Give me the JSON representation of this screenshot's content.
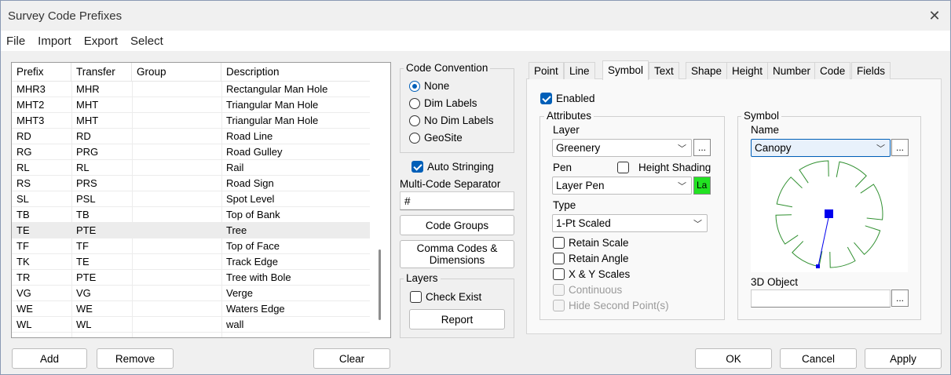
{
  "window": {
    "title": "Survey Code Prefixes"
  },
  "menu": [
    "File",
    "Import",
    "Export",
    "Select"
  ],
  "list": {
    "columns": [
      "Prefix",
      "Transfer",
      "Group",
      "Description"
    ],
    "rows": [
      [
        "MHR3",
        "MHR",
        "",
        "Rectangular Man Hole"
      ],
      [
        "MHT2",
        "MHT",
        "",
        "Triangular Man Hole"
      ],
      [
        "MHT3",
        "MHT",
        "",
        "Triangular Man Hole"
      ],
      [
        "RD",
        "RD",
        "",
        "Road Line"
      ],
      [
        "RG",
        "PRG",
        "",
        "Road Gulley"
      ],
      [
        "RL",
        "RL",
        "",
        "Rail"
      ],
      [
        "RS",
        "PRS",
        "",
        "Road Sign"
      ],
      [
        "SL",
        "PSL",
        "",
        "Spot Level"
      ],
      [
        "TB",
        "TB",
        "",
        "Top of Bank"
      ],
      [
        "TE",
        "PTE",
        "",
        "Tree"
      ],
      [
        "TF",
        "TF",
        "",
        "Top of Face"
      ],
      [
        "TK",
        "TE",
        "",
        "Track Edge"
      ],
      [
        "TR",
        "PTE",
        "",
        "Tree with Bole"
      ],
      [
        "VG",
        "VG",
        "",
        "Verge"
      ],
      [
        "WE",
        "WE",
        "",
        "Waters Edge"
      ],
      [
        "WL",
        "WL",
        "",
        "wall"
      ]
    ],
    "selected_index": 9
  },
  "code_convention": {
    "label": "Code Convention",
    "options": [
      "None",
      "Dim Labels",
      "No Dim Labels",
      "GeoSite"
    ],
    "selected": "None"
  },
  "auto_stringing": {
    "label": "Auto Stringing",
    "checked": true
  },
  "multi_code_separator": {
    "label": "Multi-Code Separator",
    "value": "#"
  },
  "buttons": {
    "code_groups": "Code Groups",
    "comma_codes_line1": "Comma Codes &",
    "comma_codes_line2": "Dimensions",
    "report": "Report",
    "add": "Add",
    "remove": "Remove",
    "clear": "Clear",
    "ok": "OK",
    "cancel": "Cancel",
    "apply": "Apply",
    "ellipsis": "..."
  },
  "layers": {
    "label": "Layers",
    "check_exist": "Check Exist",
    "check_exist_checked": false
  },
  "tabs": [
    "Point",
    "Line",
    "Symbol",
    "Text",
    "Shape",
    "Height",
    "Number",
    "Code",
    "Fields"
  ],
  "active_tab": "Symbol",
  "symbol_tab": {
    "enabled": {
      "label": "Enabled",
      "checked": true
    },
    "attributes": {
      "label": "Attributes",
      "layer_label": "Layer",
      "layer_value": "Greenery",
      "pen_label": "Pen",
      "height_shading_label": "Height Shading",
      "height_shading_checked": false,
      "pen_value": "Layer Pen",
      "pen_swatch_text": "La",
      "pen_swatch_color": "#22e222",
      "type_label": "Type",
      "type_value": "1-Pt Scaled",
      "retain_scale": "Retain Scale",
      "retain_angle": "Retain Angle",
      "xy_scales": "X & Y Scales",
      "continuous": "Continuous",
      "hide_second_points": "Hide Second Point(s)"
    },
    "symbol": {
      "label": "Symbol",
      "name_label": "Name",
      "name_value": "Canopy",
      "object_3d_label": "3D Object",
      "object_3d_value": "",
      "preview_stroke": "#2f8f2f",
      "handle_color": "#0000ee"
    }
  },
  "colors": {
    "accent": "#005fb8",
    "selected_row": "#ececec"
  }
}
